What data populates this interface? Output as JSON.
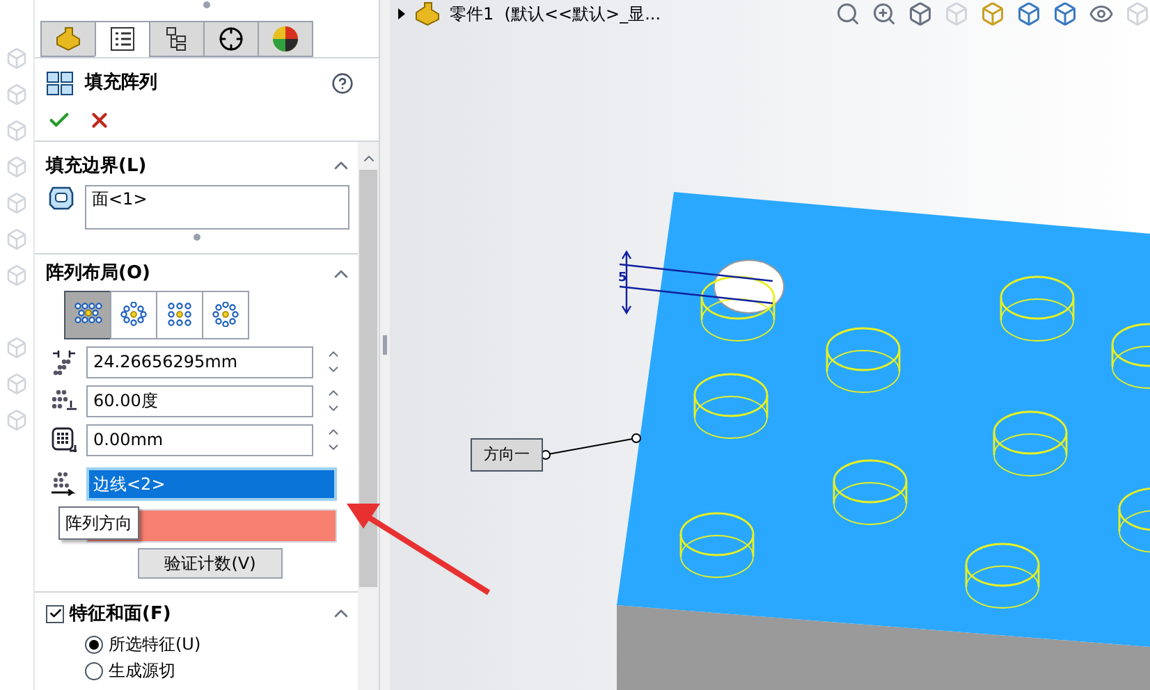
{
  "tabs": [
    {
      "selected": false
    },
    {
      "selected": true
    },
    {
      "selected": false
    },
    {
      "selected": false
    },
    {
      "selected": false
    }
  ],
  "feature": {
    "title": "填充阵列"
  },
  "fill_boundary": {
    "title": "填充边界(L)",
    "expanded": true,
    "selection": "面<1>"
  },
  "pattern_layout": {
    "title": "阵列布局(O)",
    "expanded": true,
    "layouts": [
      {
        "selected": true
      },
      {
        "selected": false
      },
      {
        "selected": false
      },
      {
        "selected": false
      }
    ],
    "fields": [
      {
        "value": "24.26656295mm"
      },
      {
        "value": "60.00度"
      },
      {
        "value": "0.00mm"
      }
    ],
    "direction": {
      "value": "边线<2>",
      "selected": true
    },
    "tooltip": "阵列方向",
    "verify_button": "验证计数(V)"
  },
  "features_and_faces": {
    "title": "特征和面(F)",
    "checked": true,
    "expanded": true,
    "options": [
      {
        "label": "所选特征(U)",
        "selected": true
      },
      {
        "label": "生成源切",
        "selected": false
      }
    ]
  },
  "viewport": {
    "tree_path": "零件1  (默认<<默认>_显...",
    "dimension": "5",
    "callout": "方向一"
  }
}
